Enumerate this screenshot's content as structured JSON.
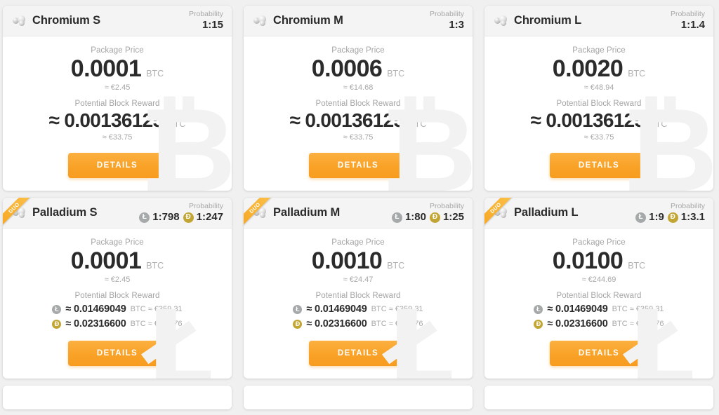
{
  "labels": {
    "probability": "Probability",
    "package_price": "Package Price",
    "potential_block_reward": "Potential Block Reward",
    "details": "DETAILS",
    "btc_unit": "BTC",
    "duo_badge": "DUO"
  },
  "colors": {
    "accent": "#f9a227",
    "accent_light": "#fbb040",
    "card_bg": "#ffffff",
    "header_bg": "#f4f4f4",
    "page_bg": "#f0f0f0",
    "text": "#2b2b2b",
    "muted": "#a8a8a8",
    "litecoin": "#a6a9aa",
    "dogecoin": "#c2a633"
  },
  "icons": {
    "chromium": "metallic-spheres-icon",
    "palladium": "metallic-spheres-icon",
    "litecoin": "litecoin-icon",
    "dogecoin": "dogecoin-icon",
    "litecoin_glyph": "Ł",
    "dogecoin_glyph": "Ɖ"
  },
  "cards": [
    {
      "id": "chromium-s",
      "title": "Chromium S",
      "type": "single",
      "watermark": "₿",
      "probability_label": "Probability",
      "probability": "1:15",
      "price_label": "Package Price",
      "price": "0.0001",
      "price_unit": "BTC",
      "price_fiat": "≈ €2.45",
      "reward_label": "Potential Block Reward",
      "reward": "≈ 0.00136125",
      "reward_unit": "BTC",
      "reward_fiat": "≈ €33.75",
      "button": "DETAILS"
    },
    {
      "id": "chromium-m",
      "title": "Chromium M",
      "type": "single",
      "watermark": "₿",
      "probability_label": "Probability",
      "probability": "1:3",
      "price_label": "Package Price",
      "price": "0.0006",
      "price_unit": "BTC",
      "price_fiat": "≈ €14.68",
      "reward_label": "Potential Block Reward",
      "reward": "≈ 0.00136125",
      "reward_unit": "BTC",
      "reward_fiat": "≈ €33.75",
      "button": "DETAILS"
    },
    {
      "id": "chromium-l",
      "title": "Chromium L",
      "type": "single",
      "watermark": "₿",
      "probability_label": "Probability",
      "probability": "1:1.4",
      "price_label": "Package Price",
      "price": "0.0020",
      "price_unit": "BTC",
      "price_fiat": "≈ €48.94",
      "reward_label": "Potential Block Reward",
      "reward": "≈ 0.00136125",
      "reward_unit": "BTC",
      "reward_fiat": "≈ €33.75",
      "button": "DETAILS"
    },
    {
      "id": "palladium-s",
      "title": "Palladium S",
      "type": "dual",
      "badge": "DUO",
      "watermark": "Ł",
      "probability_label": "Probability",
      "probability_ltc": "1:798",
      "probability_doge": "1:247",
      "price_label": "Package Price",
      "price": "0.0001",
      "price_unit": "BTC",
      "price_fiat": "≈ €2.45",
      "reward_label": "Potential Block Reward",
      "reward_ltc": "≈ 0.01469049",
      "reward_ltc_sub": "BTC ≈ €359.31",
      "reward_doge": "≈ 0.02316600",
      "reward_doge_sub": "BTC ≈ €565.76",
      "button": "DETAILS"
    },
    {
      "id": "palladium-m",
      "title": "Palladium M",
      "type": "dual",
      "badge": "DUO",
      "watermark": "Ł",
      "probability_label": "Probability",
      "probability_ltc": "1:80",
      "probability_doge": "1:25",
      "price_label": "Package Price",
      "price": "0.0010",
      "price_unit": "BTC",
      "price_fiat": "≈ €24.47",
      "reward_label": "Potential Block Reward",
      "reward_ltc": "≈ 0.01469049",
      "reward_ltc_sub": "BTC ≈ €359.31",
      "reward_doge": "≈ 0.02316600",
      "reward_doge_sub": "BTC ≈ €565.76",
      "button": "DETAILS"
    },
    {
      "id": "palladium-l",
      "title": "Palladium L",
      "type": "dual",
      "badge": "DUO",
      "watermark": "Ł",
      "probability_label": "Probability",
      "probability_ltc": "1:9",
      "probability_doge": "1:3.1",
      "price_label": "Package Price",
      "price": "0.0100",
      "price_unit": "BTC",
      "price_fiat": "≈ €244.69",
      "reward_label": "Potential Block Reward",
      "reward_ltc": "≈ 0.01469049",
      "reward_ltc_sub": "BTC ≈ €359.31",
      "reward_doge": "≈ 0.02316600",
      "reward_doge_sub": "BTC ≈ €565.76",
      "button": "DETAILS"
    }
  ],
  "row_peek": [
    {
      "id": "peek-1"
    },
    {
      "id": "peek-2"
    },
    {
      "id": "peek-3"
    }
  ]
}
